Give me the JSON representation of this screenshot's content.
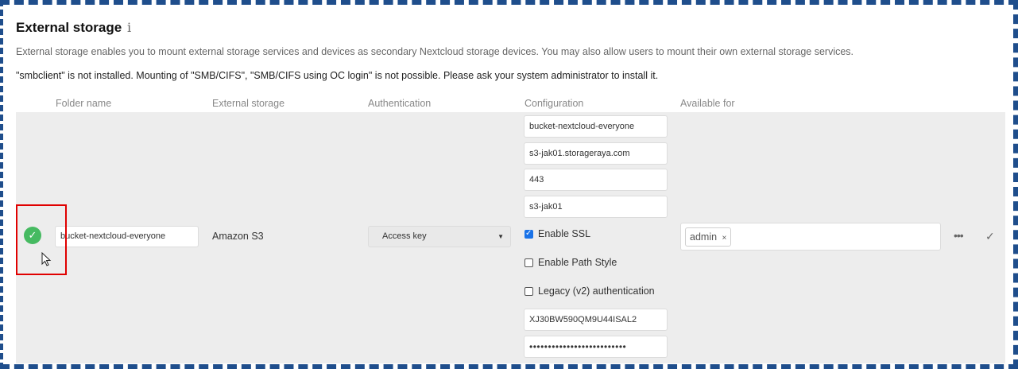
{
  "section": {
    "title": "External storage",
    "info_icon": "i",
    "description": "External storage enables you to mount external storage services and devices as secondary Nextcloud storage devices. You may also allow users to mount their own external storage services.",
    "warning": "\"smbclient\" is not installed. Mounting of \"SMB/CIFS\", \"SMB/CIFS using OC login\" is not possible. Please ask your system administrator to install it."
  },
  "table": {
    "headers": {
      "folder_name": "Folder name",
      "external_storage": "External storage",
      "authentication": "Authentication",
      "configuration": "Configuration",
      "available_for": "Available for"
    }
  },
  "row": {
    "status_icon": "check-circle-icon",
    "status_color": "#46ba61",
    "folder_name": "bucket-nextcloud-everyone",
    "external_storage": "Amazon S3",
    "authentication": "Access key",
    "config": {
      "bucket": "bucket-nextcloud-everyone",
      "hostname": "s3-jak01.storageraya.com",
      "port": "443",
      "region": "s3-jak01",
      "enable_ssl_label": "Enable SSL",
      "enable_ssl": true,
      "path_style_label": "Enable Path Style",
      "path_style": false,
      "legacy_auth_label": "Legacy (v2) authentication",
      "legacy_auth": false,
      "access_key": "XJ30BW590QM9U44ISAL2",
      "secret_key": "••••••••••••••••••••••••••"
    },
    "available_for": [
      {
        "label": "admin",
        "remove": "×"
      }
    ],
    "more_icon": "•••",
    "save_icon": "✓"
  },
  "annotation": {
    "highlight_color": "#e00000"
  }
}
